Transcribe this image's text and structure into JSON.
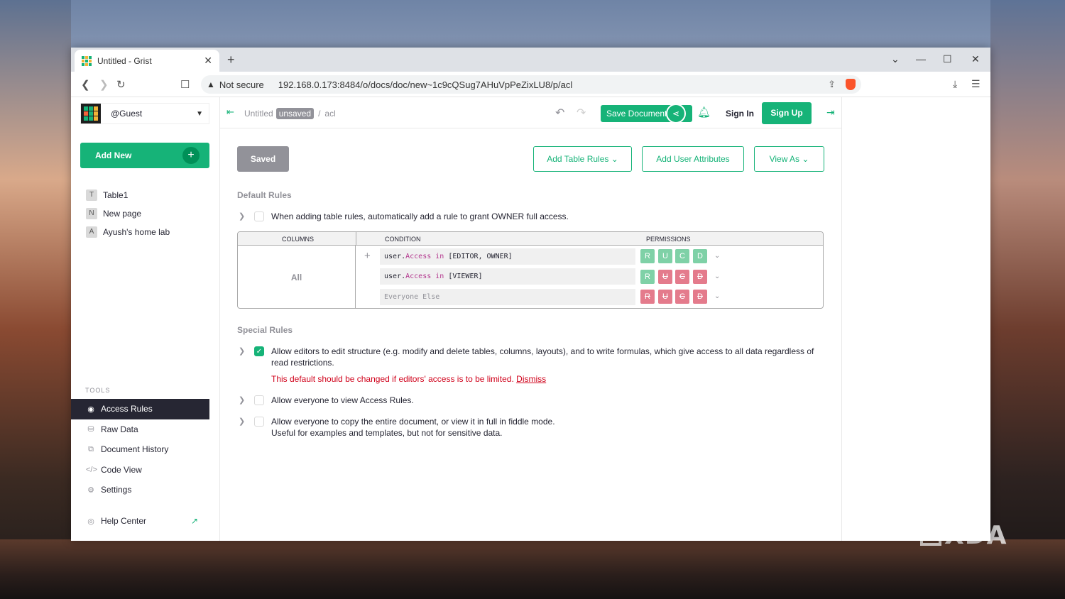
{
  "browser": {
    "tab_title": "Untitled - Grist",
    "url_warning": "Not secure",
    "url": "192.168.0.173:8484/o/docs/doc/new~1c9cQSug7AHuVpPeZixLU8/p/acl"
  },
  "sidebar": {
    "org_name": "@Guest",
    "add_new": "Add New",
    "pages": [
      {
        "initial": "T",
        "label": "Table1"
      },
      {
        "initial": "N",
        "label": "New page"
      },
      {
        "initial": "A",
        "label": "Ayush's home lab"
      }
    ],
    "tools_title": "TOOLS",
    "tools": [
      {
        "label": "Access Rules",
        "icon": "eye-icon"
      },
      {
        "label": "Raw Data",
        "icon": "database-icon"
      },
      {
        "label": "Document History",
        "icon": "history-icon"
      },
      {
        "label": "Code View",
        "icon": "code-icon"
      },
      {
        "label": "Settings",
        "icon": "gear-icon"
      }
    ],
    "help": "Help Center"
  },
  "topbar": {
    "doc_name": "Untitled",
    "unsaved_badge": "unsaved",
    "page": "acl",
    "save_document": "Save Document",
    "sign_in": "Sign In",
    "sign_up": "Sign Up"
  },
  "acl": {
    "saved_button": "Saved",
    "add_table_rules": "Add Table Rules",
    "add_user_attributes": "Add User Attributes",
    "view_as": "View As",
    "default_rules_title": "Default Rules",
    "default_owner_rule": "When adding table rules, automatically add a rule to grant OWNER full access.",
    "table_headers": {
      "columns": "COLUMNS",
      "condition": "CONDITION",
      "permissions": "PERMISSIONS"
    },
    "columns_value": "All",
    "rules": [
      {
        "condition_prefix": "user.",
        "condition_attr": "Access",
        "condition_op": "in",
        "condition_value": "[EDITOR, OWNER]",
        "permissions": [
          "R",
          "U",
          "C",
          "D"
        ],
        "allowed": [
          true,
          true,
          true,
          true
        ]
      },
      {
        "condition_prefix": "user.",
        "condition_attr": "Access",
        "condition_op": "in",
        "condition_value": "[VIEWER]",
        "permissions": [
          "R",
          "U",
          "C",
          "D"
        ],
        "allowed": [
          true,
          false,
          false,
          false
        ]
      },
      {
        "condition_placeholder": "Everyone Else",
        "permissions": [
          "R",
          "U",
          "C",
          "D"
        ],
        "allowed": [
          false,
          false,
          false,
          false
        ]
      }
    ],
    "special_rules_title": "Special Rules",
    "special_rules": [
      {
        "text": "Allow editors to edit structure (e.g. modify and delete tables, columns, layouts), and to write formulas, which give access to all data regardless of read restrictions.",
        "checked": true
      },
      {
        "text": "Allow everyone to view Access Rules.",
        "checked": false
      },
      {
        "text": "Allow everyone to copy the entire document, or view it in full in fiddle mode.",
        "subtext": "Useful for examples and templates, but not for sensitive data.",
        "checked": false
      }
    ],
    "warning_text": "This default should be changed if editors' access is to be limited.",
    "dismiss": "Dismiss"
  },
  "watermark": "XDA",
  "colors": {
    "accent": "#16b378",
    "sidebar_active": "#262633",
    "deny": "#e47b8c",
    "allow": "#7fd1a7",
    "warning": "#d0021b"
  }
}
